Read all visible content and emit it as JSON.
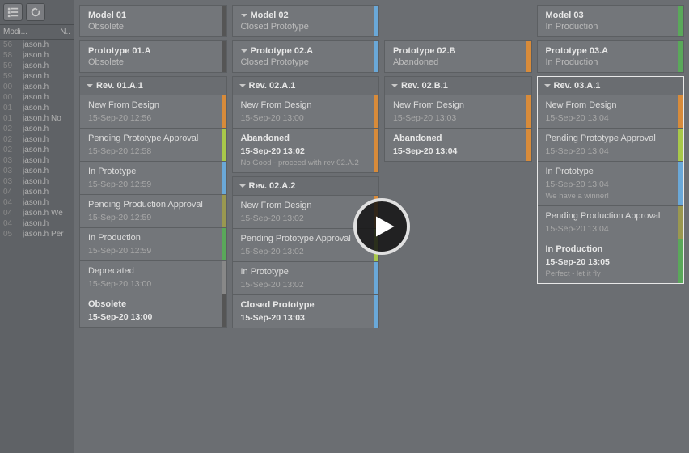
{
  "sidebar_head": {
    "c1": "Modi...",
    "c2": "N.."
  },
  "sidebar": [
    {
      "n": "56",
      "v": "jason.h"
    },
    {
      "n": "58",
      "v": "jason.h"
    },
    {
      "n": "59",
      "v": "jason.h"
    },
    {
      "n": "59",
      "v": "jason.h"
    },
    {
      "n": "00",
      "v": "jason.h"
    },
    {
      "n": "00",
      "v": "jason.h"
    },
    {
      "n": "01",
      "v": "jason.h"
    },
    {
      "n": "01",
      "v": "jason.h No"
    },
    {
      "n": "02",
      "v": "jason.h"
    },
    {
      "n": "02",
      "v": "jason.h"
    },
    {
      "n": "02",
      "v": "jason.h"
    },
    {
      "n": "03",
      "v": "jason.h"
    },
    {
      "n": "03",
      "v": "jason.h"
    },
    {
      "n": "03",
      "v": "jason.h"
    },
    {
      "n": "04",
      "v": "jason.h"
    },
    {
      "n": "04",
      "v": "jason.h"
    },
    {
      "n": "04",
      "v": "jason.h We"
    },
    {
      "n": "04",
      "v": "jason.h"
    },
    {
      "n": "05",
      "v": "jason.h Per"
    }
  ],
  "columns": [
    {
      "model": {
        "title": "Model 01",
        "status": "Obsolete",
        "stripe": "c-dark",
        "expand": false
      },
      "proto": {
        "title": "Prototype 01.A",
        "status": "Obsolete",
        "stripe": "c-dark",
        "expand": false
      },
      "rev_title": "Rev. 01.A.1",
      "cards": [
        {
          "title": "New From Design",
          "ts": "15-Sep-20 12:56",
          "stripe": "c-orange"
        },
        {
          "title": "Pending Prototype Approval",
          "ts": "15-Sep-20 12:58",
          "stripe": "c-lime"
        },
        {
          "title": "In Prototype",
          "ts": "15-Sep-20 12:59",
          "stripe": "c-blue"
        },
        {
          "title": "Pending Production Approval",
          "ts": "15-Sep-20 12:59",
          "stripe": "c-olive"
        },
        {
          "title": "In Production",
          "ts": "15-Sep-20 12:59",
          "stripe": "c-green"
        },
        {
          "title": "Deprecated",
          "ts": "15-Sep-20 13:00",
          "stripe": "c-gray"
        },
        {
          "title": "Obsolete",
          "ts": "15-Sep-20 13:00",
          "stripe": "c-dark",
          "bold": true
        }
      ]
    },
    {
      "model": {
        "title": "Model 02",
        "status": "Closed Prototype",
        "stripe": "c-blue",
        "expand": true
      },
      "proto": {
        "title": "Prototype 02.A",
        "status": "Closed Prototype",
        "stripe": "c-blue",
        "expand": true
      },
      "rev_title": "Rev. 02.A.1",
      "cards": [
        {
          "title": "New From Design",
          "ts": "15-Sep-20 13:00",
          "stripe": "c-orange"
        },
        {
          "title": "Abandoned",
          "ts": "15-Sep-20 13:02",
          "note": "No Good - proceed with rev 02.A.2",
          "stripe": "c-orange",
          "bold": true
        }
      ],
      "rev2_title": "Rev. 02.A.2",
      "cards2": [
        {
          "title": "New From Design",
          "ts": "15-Sep-20 13:02",
          "stripe": "c-orange"
        },
        {
          "title": "Pending Prototype Approval",
          "ts": "15-Sep-20 13:02",
          "stripe": "c-lime"
        },
        {
          "title": "In Prototype",
          "ts": "15-Sep-20 13:02",
          "stripe": "c-blue"
        },
        {
          "title": "Closed Prototype",
          "ts": "15-Sep-20 13:03",
          "stripe": "c-blue",
          "bold": true
        }
      ]
    },
    {
      "proto": {
        "title": "Prototype 02.B",
        "status": "Abandoned",
        "stripe": "c-orange",
        "expand": false
      },
      "rev_title": "Rev. 02.B.1",
      "cards": [
        {
          "title": "New From Design",
          "ts": "15-Sep-20 13:03",
          "stripe": "c-orange"
        },
        {
          "title": "Abandoned",
          "ts": "15-Sep-20 13:04",
          "stripe": "c-orange",
          "bold": true
        }
      ]
    },
    {
      "model": {
        "title": "Model 03",
        "status": "In Production",
        "stripe": "c-green",
        "expand": false
      },
      "proto": {
        "title": "Prototype 03.A",
        "status": "In Production",
        "stripe": "c-green",
        "expand": false
      },
      "rev_title": "Rev. 03.A.1",
      "selected": true,
      "cards": [
        {
          "title": "New From Design",
          "ts": "15-Sep-20 13:04",
          "stripe": "c-orange"
        },
        {
          "title": "Pending Prototype Approval",
          "ts": "15-Sep-20 13:04",
          "stripe": "c-lime"
        },
        {
          "title": "In Prototype",
          "ts": "15-Sep-20 13:04",
          "note": "We have a winner!",
          "stripe": "c-blue"
        },
        {
          "title": "Pending Production Approval",
          "ts": "15-Sep-20 13:04",
          "stripe": "c-olive"
        },
        {
          "title": "In Production",
          "ts": "15-Sep-20 13:05",
          "note": "Perfect - let it fly",
          "stripe": "c-green",
          "bold": true
        }
      ]
    }
  ]
}
